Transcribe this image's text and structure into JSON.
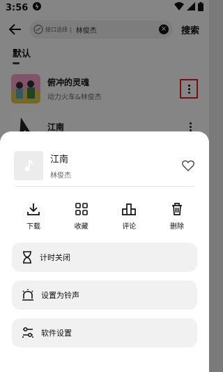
{
  "status_bar": {
    "time": "3:56"
  },
  "top_bar": {
    "search_chip": "接口选择",
    "search_query": "林俊杰",
    "search_button": "搜索"
  },
  "section": {
    "title": "默认"
  },
  "songs": [
    {
      "title": "俯冲的灵魂",
      "artist": "动力火车&林俊杰"
    },
    {
      "title": "江南",
      "artist": ""
    }
  ],
  "sheet": {
    "song_title": "江南",
    "artist": "林俊杰",
    "actions": [
      "下载",
      "收藏",
      "评论",
      "删除"
    ],
    "menu": [
      "计时关闭",
      "设置为铃声",
      "软件设置"
    ]
  },
  "colors": {
    "highlight": "#e01919"
  }
}
